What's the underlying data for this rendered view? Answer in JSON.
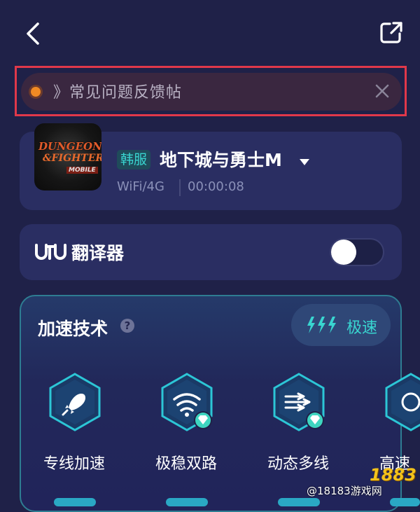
{
  "header": {
    "back_icon": "chevron-left-icon",
    "share_icon": "share-external-icon"
  },
  "notice": {
    "text": "》常见问题反馈帖",
    "close_icon": "close-icon",
    "dot_color": "#f08a24"
  },
  "game": {
    "logo_line1": "DUNGEON",
    "logo_line2": "&FIGHTER",
    "logo_line3": "MOBILE",
    "server_badge": "韩服",
    "name": "地下城与勇士M",
    "network": "WiFi/4G",
    "elapsed": "00:00:08"
  },
  "translator": {
    "label": "翻译器",
    "enabled": false
  },
  "acceleration": {
    "title": "加速技术",
    "help_icon_text": "?",
    "mode_label": "极速",
    "features": [
      {
        "label": "专线加速",
        "icon": "rocket-icon",
        "premium": false
      },
      {
        "label": "极稳双路",
        "icon": "wifi-signal-icon",
        "premium": true
      },
      {
        "label": "动态多线",
        "icon": "multi-route-icon",
        "premium": true
      },
      {
        "label": "高速",
        "icon": "highspeed-icon",
        "premium": false
      }
    ]
  },
  "watermark": {
    "brand": "1883",
    "text": "@18183游戏网"
  },
  "colors": {
    "accent": "#39d5d0",
    "background": "#1f2148",
    "card": "#2a2e62",
    "highlight_box": "#e0384a"
  }
}
